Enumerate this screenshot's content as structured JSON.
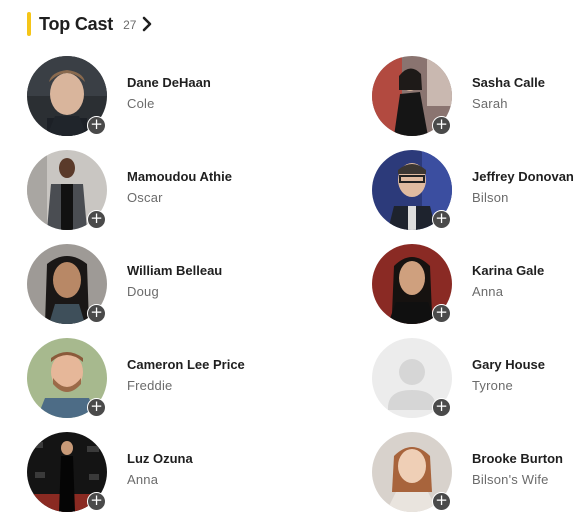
{
  "section": {
    "title": "Top Cast",
    "count": "27",
    "accent_color": "#f5c518"
  },
  "cast": [
    {
      "name": "Dane DeHaan",
      "role": "Cole"
    },
    {
      "name": "Sasha Calle",
      "role": "Sarah"
    },
    {
      "name": "Mamoudou Athie",
      "role": "Oscar"
    },
    {
      "name": "Jeffrey Donovan",
      "role": "Bilson"
    },
    {
      "name": "William Belleau",
      "role": "Doug"
    },
    {
      "name": "Karina Gale",
      "role": "Anna"
    },
    {
      "name": "Cameron Lee Price",
      "role": "Freddie"
    },
    {
      "name": "Gary House",
      "role": "Tyrone"
    },
    {
      "name": "Luz Ozuna",
      "role": "Anna"
    },
    {
      "name": "Brooke Burton",
      "role": "Bilson's Wife"
    }
  ],
  "icons": {
    "add": "+",
    "chevron": "chevron-right-icon",
    "placeholder": "person-placeholder-icon"
  }
}
